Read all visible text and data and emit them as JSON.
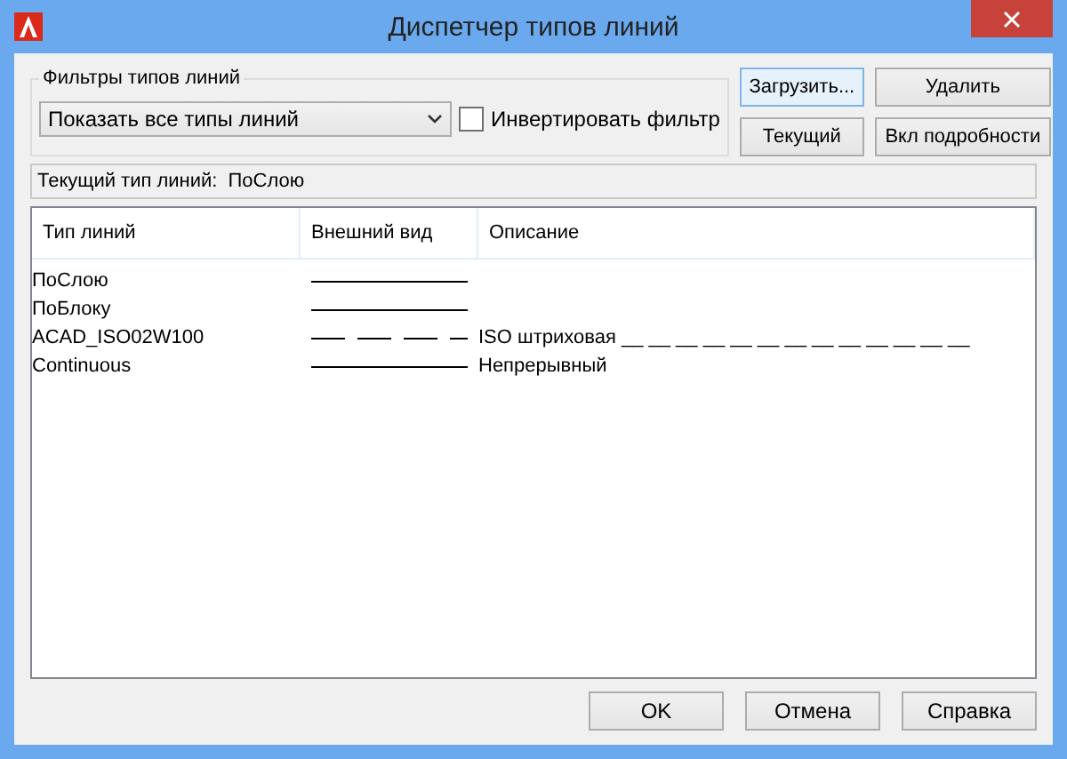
{
  "window": {
    "title": "Диспетчер типов линий"
  },
  "filters": {
    "label": "Фильтры типов линий",
    "dropdown": "Показать все типы линий",
    "invert": {
      "label": "Инвертировать фильтр",
      "checked": false
    }
  },
  "side_buttons": [
    "Загрузить...",
    "Удалить",
    "Текущий",
    "Вкл подробности"
  ],
  "current": {
    "label": "Текущий тип линий:",
    "value": "ПоСлою"
  },
  "table": {
    "columns": [
      "Тип линий",
      "Внешний вид",
      "Описание"
    ],
    "rows": [
      {
        "name": "ПоСлою",
        "kind": "solid"
      },
      {
        "name": "ПоБлоку",
        "kind": "solid"
      },
      {
        "name": "ACAD_ISO02W100",
        "kind": "dashed",
        "description": "ISO штриховая __ __ __ __ __ __ __ __ __ __ __ __ __"
      },
      {
        "name": "Continuous",
        "kind": "solid",
        "description": "Непрерывный"
      }
    ]
  },
  "buttons": [
    "OK",
    "Отмена",
    "Справка"
  ]
}
